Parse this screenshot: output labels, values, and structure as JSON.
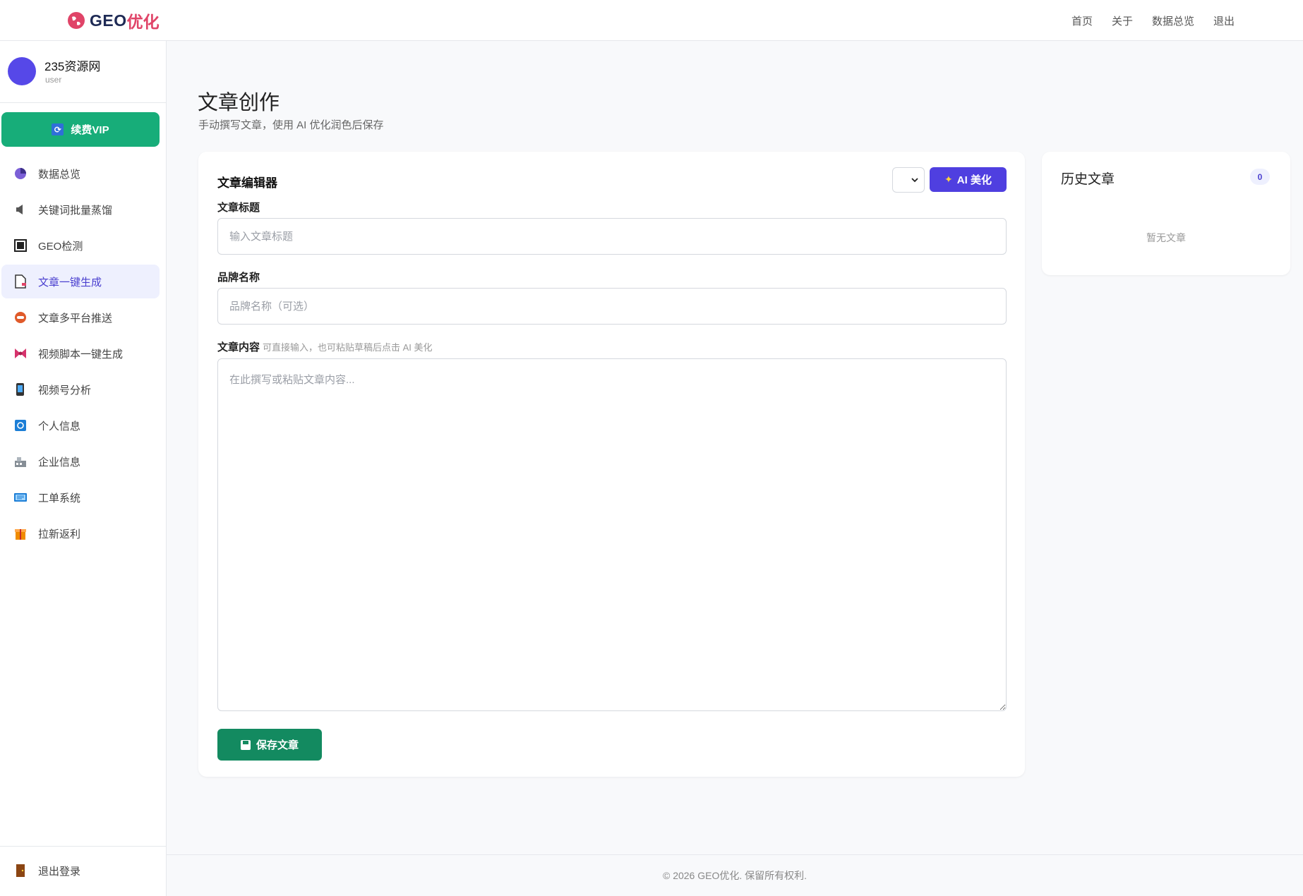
{
  "header": {
    "brand_geo": "GEO",
    "brand_opt": "优化",
    "nav": [
      "首页",
      "关于",
      "数据总览",
      "退出"
    ]
  },
  "sidebar": {
    "profile": {
      "name": "235资源网",
      "role": "user"
    },
    "vip_label": "续费VIP",
    "items": [
      {
        "label": "数据总览",
        "icon": "chart-icon"
      },
      {
        "label": "关键词批量蒸馏",
        "icon": "megaphone-icon"
      },
      {
        "label": "GEO检测",
        "icon": "square-icon"
      },
      {
        "label": "文章一键生成",
        "icon": "document-icon",
        "active": true
      },
      {
        "label": "文章多平台推送",
        "icon": "push-icon"
      },
      {
        "label": "视频脚本一键生成",
        "icon": "ribbon-icon"
      },
      {
        "label": "视频号分析",
        "icon": "phone-icon"
      },
      {
        "label": "个人信息",
        "icon": "profile-icon"
      },
      {
        "label": "企业信息",
        "icon": "building-icon"
      },
      {
        "label": "工单系统",
        "icon": "ticket-icon"
      },
      {
        "label": "拉新返利",
        "icon": "gift-icon"
      }
    ],
    "logout_label": "退出登录"
  },
  "main": {
    "title": "文章创作",
    "subtitle": "手动撰写文章，使用 AI 优化润色后保存",
    "editor": {
      "title": "文章编辑器",
      "ai_button": "AI 美化",
      "title_label": "文章标题",
      "title_placeholder": "输入文章标题",
      "brand_label": "品牌名称",
      "brand_placeholder": "品牌名称（可选）",
      "content_label": "文章内容",
      "content_hint": "可直接输入，也可粘贴草稿后点击 AI 美化",
      "content_placeholder": "在此撰写或粘贴文章内容...",
      "save_button": "保存文章"
    },
    "history": {
      "title": "历史文章",
      "count": "0",
      "empty_text": "暂无文章"
    }
  },
  "footer": {
    "text": "© 2026 GEO优化. 保留所有权利."
  },
  "colors": {
    "accent": "#4f3fe0",
    "vip_green": "#17ad79",
    "save_green": "#138a60",
    "brand_red": "#e04468",
    "active_bg": "#eef0fe"
  }
}
